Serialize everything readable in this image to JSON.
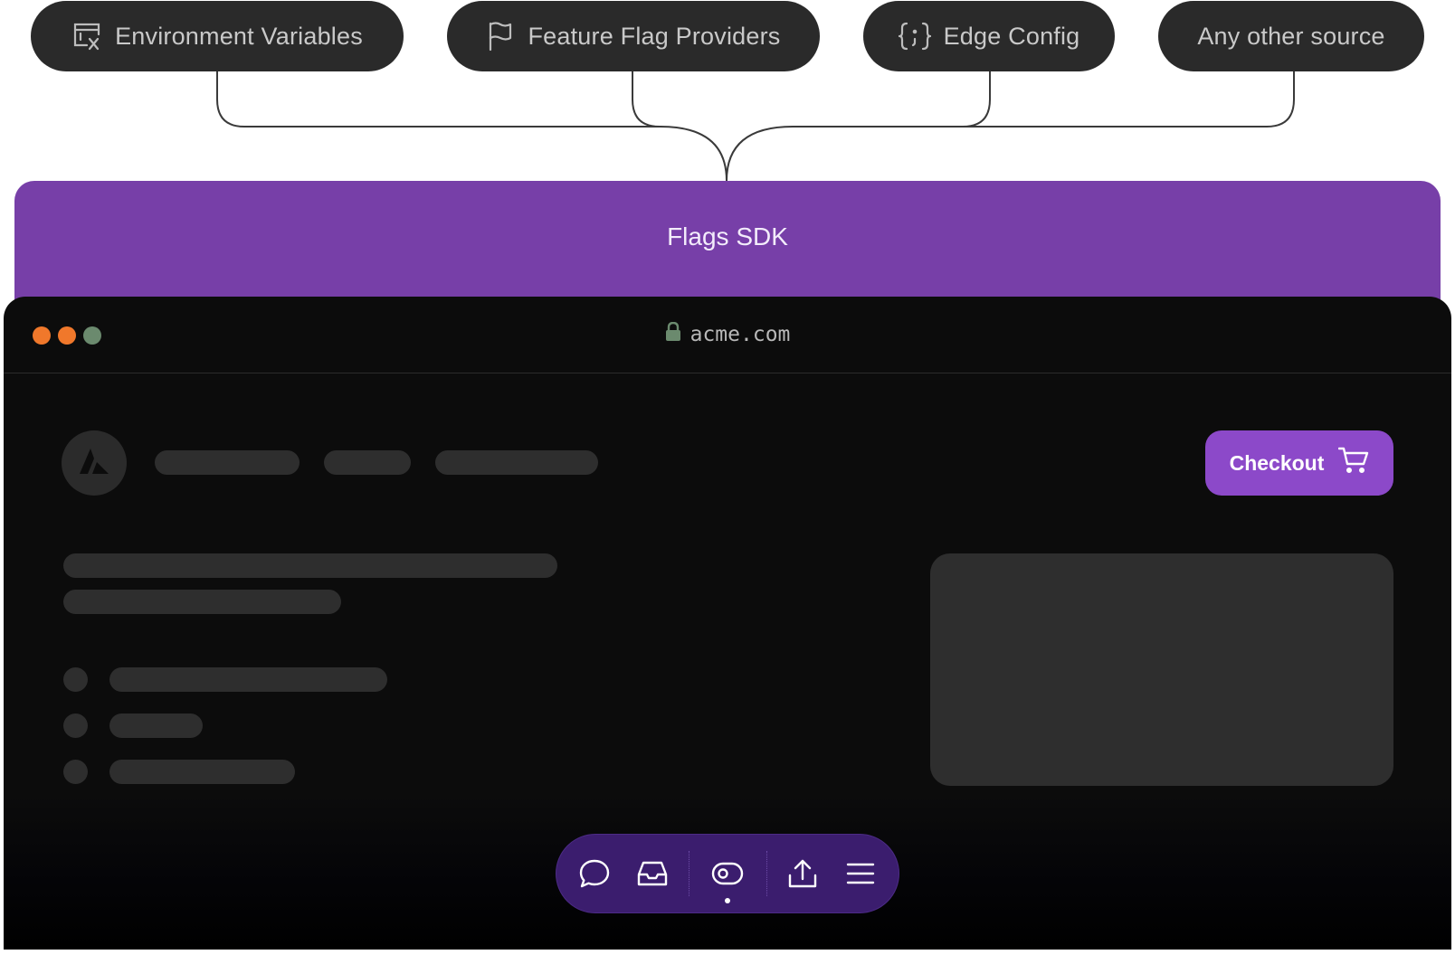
{
  "sources": [
    {
      "label": "Environment Variables",
      "icon": "env-variable-icon"
    },
    {
      "label": "Feature Flag Providers",
      "icon": "flag-icon"
    },
    {
      "label": "Edge Config",
      "icon": "braces-icon"
    },
    {
      "label": "Any other source",
      "icon": ""
    }
  ],
  "sdk": {
    "label": "Flags SDK",
    "color": "#773fa8"
  },
  "browser": {
    "url": "acme.com",
    "traffic_lights": [
      "#f0782b",
      "#f0782b",
      "#6b8a6e"
    ],
    "checkout_label": "Checkout",
    "accent": "#8c49c9"
  },
  "toolbar": {
    "icons": [
      "comment-icon",
      "inbox-icon",
      "eye-icon",
      "share-icon",
      "menu-icon"
    ],
    "active": "eye-icon",
    "background": "#3b1d6e"
  }
}
